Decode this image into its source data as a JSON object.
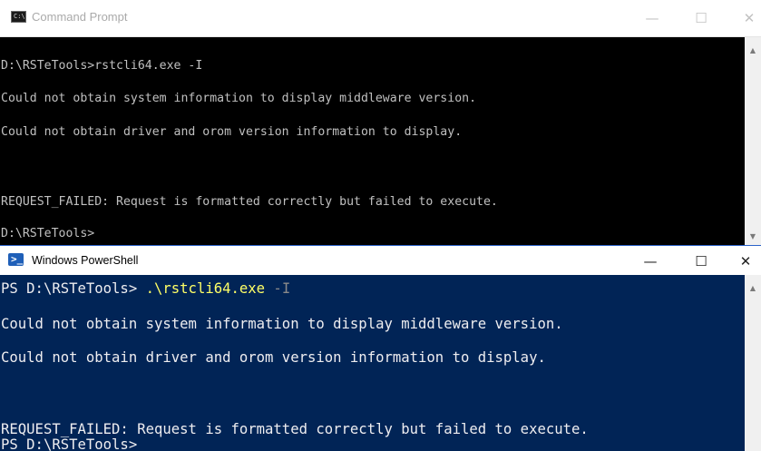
{
  "cmd": {
    "title": "Command Prompt",
    "icon_text": "C:\\",
    "buttons": {
      "minimize": "—",
      "maximize": "☐",
      "close": "✕"
    },
    "lines": [
      "D:\\RSTeTools>rstcli64.exe -I",
      "Could not obtain system information to display middleware version.",
      "Could not obtain driver and orom version information to display.",
      "REQUEST_FAILED: Request is formatted correctly but failed to execute.",
      "D:\\RSTeTools>"
    ],
    "colors": {
      "background": "#000000",
      "text": "#c0c0c0"
    }
  },
  "powershell": {
    "title": "Windows PowerShell",
    "icon_text": ">_",
    "buttons": {
      "minimize": "—",
      "maximize": "☐",
      "close": "✕"
    },
    "prompt": "PS D:\\RSTeTools> ",
    "command": ".\\rstcli64.exe",
    "param": " -I",
    "lines": [
      "Could not obtain system information to display middleware version.",
      "Could not obtain driver and orom version information to display.",
      "REQUEST_FAILED: Request is formatted correctly but failed to execute.",
      "PS D:\\RSTeTools>"
    ],
    "colors": {
      "background": "#012456",
      "text": "#eeedf0",
      "command": "#ffff66",
      "parameter": "#8a8a8a"
    }
  }
}
